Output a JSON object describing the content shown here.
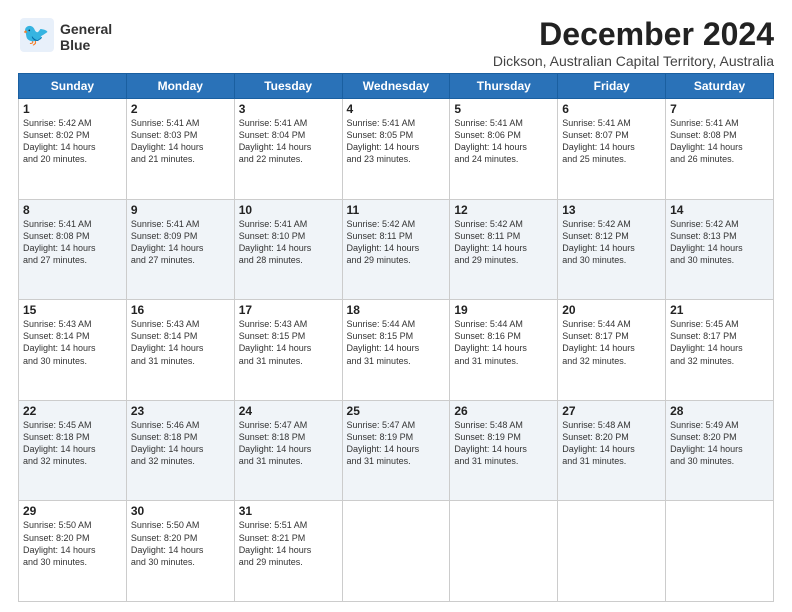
{
  "logo": {
    "line1": "General",
    "line2": "Blue"
  },
  "title": "December 2024",
  "subtitle": "Dickson, Australian Capital Territory, Australia",
  "weekdays": [
    "Sunday",
    "Monday",
    "Tuesday",
    "Wednesday",
    "Thursday",
    "Friday",
    "Saturday"
  ],
  "weeks": [
    [
      {
        "day": "1",
        "info": "Sunrise: 5:42 AM\nSunset: 8:02 PM\nDaylight: 14 hours\nand 20 minutes."
      },
      {
        "day": "2",
        "info": "Sunrise: 5:41 AM\nSunset: 8:03 PM\nDaylight: 14 hours\nand 21 minutes."
      },
      {
        "day": "3",
        "info": "Sunrise: 5:41 AM\nSunset: 8:04 PM\nDaylight: 14 hours\nand 22 minutes."
      },
      {
        "day": "4",
        "info": "Sunrise: 5:41 AM\nSunset: 8:05 PM\nDaylight: 14 hours\nand 23 minutes."
      },
      {
        "day": "5",
        "info": "Sunrise: 5:41 AM\nSunset: 8:06 PM\nDaylight: 14 hours\nand 24 minutes."
      },
      {
        "day": "6",
        "info": "Sunrise: 5:41 AM\nSunset: 8:07 PM\nDaylight: 14 hours\nand 25 minutes."
      },
      {
        "day": "7",
        "info": "Sunrise: 5:41 AM\nSunset: 8:08 PM\nDaylight: 14 hours\nand 26 minutes."
      }
    ],
    [
      {
        "day": "8",
        "info": "Sunrise: 5:41 AM\nSunset: 8:08 PM\nDaylight: 14 hours\nand 27 minutes."
      },
      {
        "day": "9",
        "info": "Sunrise: 5:41 AM\nSunset: 8:09 PM\nDaylight: 14 hours\nand 27 minutes."
      },
      {
        "day": "10",
        "info": "Sunrise: 5:41 AM\nSunset: 8:10 PM\nDaylight: 14 hours\nand 28 minutes."
      },
      {
        "day": "11",
        "info": "Sunrise: 5:42 AM\nSunset: 8:11 PM\nDaylight: 14 hours\nand 29 minutes."
      },
      {
        "day": "12",
        "info": "Sunrise: 5:42 AM\nSunset: 8:11 PM\nDaylight: 14 hours\nand 29 minutes."
      },
      {
        "day": "13",
        "info": "Sunrise: 5:42 AM\nSunset: 8:12 PM\nDaylight: 14 hours\nand 30 minutes."
      },
      {
        "day": "14",
        "info": "Sunrise: 5:42 AM\nSunset: 8:13 PM\nDaylight: 14 hours\nand 30 minutes."
      }
    ],
    [
      {
        "day": "15",
        "info": "Sunrise: 5:43 AM\nSunset: 8:14 PM\nDaylight: 14 hours\nand 30 minutes."
      },
      {
        "day": "16",
        "info": "Sunrise: 5:43 AM\nSunset: 8:14 PM\nDaylight: 14 hours\nand 31 minutes."
      },
      {
        "day": "17",
        "info": "Sunrise: 5:43 AM\nSunset: 8:15 PM\nDaylight: 14 hours\nand 31 minutes."
      },
      {
        "day": "18",
        "info": "Sunrise: 5:44 AM\nSunset: 8:15 PM\nDaylight: 14 hours\nand 31 minutes."
      },
      {
        "day": "19",
        "info": "Sunrise: 5:44 AM\nSunset: 8:16 PM\nDaylight: 14 hours\nand 31 minutes."
      },
      {
        "day": "20",
        "info": "Sunrise: 5:44 AM\nSunset: 8:17 PM\nDaylight: 14 hours\nand 32 minutes."
      },
      {
        "day": "21",
        "info": "Sunrise: 5:45 AM\nSunset: 8:17 PM\nDaylight: 14 hours\nand 32 minutes."
      }
    ],
    [
      {
        "day": "22",
        "info": "Sunrise: 5:45 AM\nSunset: 8:18 PM\nDaylight: 14 hours\nand 32 minutes."
      },
      {
        "day": "23",
        "info": "Sunrise: 5:46 AM\nSunset: 8:18 PM\nDaylight: 14 hours\nand 32 minutes."
      },
      {
        "day": "24",
        "info": "Sunrise: 5:47 AM\nSunset: 8:18 PM\nDaylight: 14 hours\nand 31 minutes."
      },
      {
        "day": "25",
        "info": "Sunrise: 5:47 AM\nSunset: 8:19 PM\nDaylight: 14 hours\nand 31 minutes."
      },
      {
        "day": "26",
        "info": "Sunrise: 5:48 AM\nSunset: 8:19 PM\nDaylight: 14 hours\nand 31 minutes."
      },
      {
        "day": "27",
        "info": "Sunrise: 5:48 AM\nSunset: 8:20 PM\nDaylight: 14 hours\nand 31 minutes."
      },
      {
        "day": "28",
        "info": "Sunrise: 5:49 AM\nSunset: 8:20 PM\nDaylight: 14 hours\nand 30 minutes."
      }
    ],
    [
      {
        "day": "29",
        "info": "Sunrise: 5:50 AM\nSunset: 8:20 PM\nDaylight: 14 hours\nand 30 minutes."
      },
      {
        "day": "30",
        "info": "Sunrise: 5:50 AM\nSunset: 8:20 PM\nDaylight: 14 hours\nand 30 minutes."
      },
      {
        "day": "31",
        "info": "Sunrise: 5:51 AM\nSunset: 8:21 PM\nDaylight: 14 hours\nand 29 minutes."
      },
      null,
      null,
      null,
      null
    ]
  ]
}
